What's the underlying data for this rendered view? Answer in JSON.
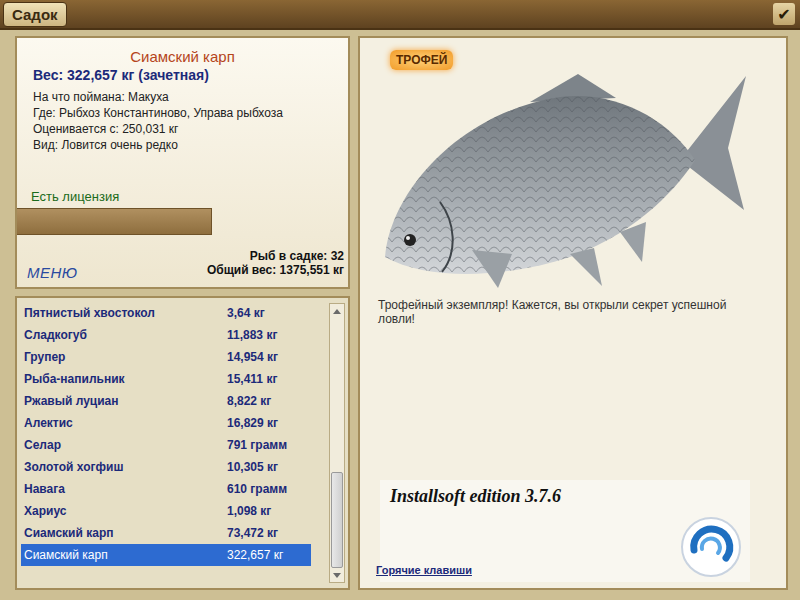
{
  "window": {
    "title": "Садок",
    "confirm": "✔"
  },
  "fish": {
    "name": "Сиамский карп",
    "weight": "Вес: 322,657 кг (зачетная)",
    "details": [
      "На что поймана: Макуха",
      "Где: Рыбхоз Константиново, Управа рыбхоза",
      "Оценивается с: 250,031 кг",
      "Вид: Ловится очень редко"
    ],
    "license": "Есть лицензия"
  },
  "summary": {
    "count": "Рыб в садке: 32",
    "total": "Общий вес: 1375,551 кг"
  },
  "menu": "МЕНЮ",
  "catch_list": {
    "rows": [
      {
        "name": "Пятнистый хвостокол",
        "weight": "3,64 кг",
        "selected": false
      },
      {
        "name": "Сладкогуб",
        "weight": "11,883 кг",
        "selected": false
      },
      {
        "name": "Групер",
        "weight": "14,954 кг",
        "selected": false
      },
      {
        "name": "Рыба-напильник",
        "weight": "15,411 кг",
        "selected": false
      },
      {
        "name": "Ржавый луциан",
        "weight": "8,822 кг",
        "selected": false
      },
      {
        "name": "Алектис",
        "weight": "16,829 кг",
        "selected": false
      },
      {
        "name": "Селар",
        "weight": "791 грамм",
        "selected": false
      },
      {
        "name": "Золотой хогфиш",
        "weight": "10,305 кг",
        "selected": false
      },
      {
        "name": "Навага",
        "weight": "610 грамм",
        "selected": false
      },
      {
        "name": "Хариус",
        "weight": "1,098 кг",
        "selected": false
      },
      {
        "name": "Сиамский карп",
        "weight": "73,472 кг",
        "selected": false
      },
      {
        "name": "Сиамский карп",
        "weight": "322,657 кг",
        "selected": true
      }
    ],
    "scrollbar": {
      "level": 1
    }
  },
  "trophy": {
    "badge": "ТРОФЕЙ",
    "message": "Трофейный экземпляр! Кажется, вы открыли секрет успешной ловли!"
  },
  "edition": {
    "label": "Installsoft edition 3.7.6"
  },
  "hotkeys": "Горячие клавиши"
}
